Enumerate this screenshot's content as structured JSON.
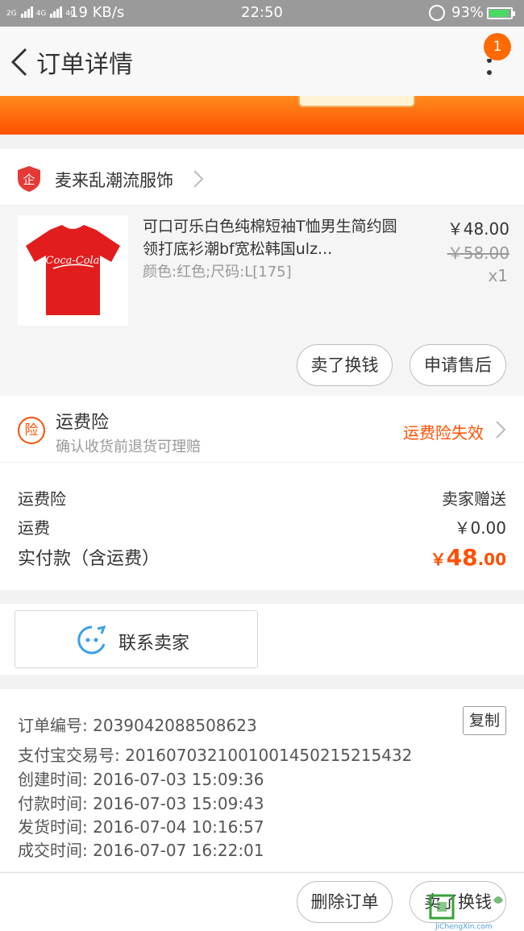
{
  "status_bar": {
    "network_tag_1": "2G",
    "network_tag_2": "4G",
    "network_tag_3": "4G",
    "speed": "19 KB/s",
    "time": "22:50",
    "battery": "93%",
    "battery_level": 0.93
  },
  "header": {
    "title": "订单详情",
    "badge_count": "1"
  },
  "shop": {
    "name": "麦来乱潮流服饰",
    "icon_label": "企"
  },
  "item": {
    "title": "可口可乐白色纯棉短袖T恤男生简约圆领打底衫潮bf宽松韩国ulz...",
    "sku": "颜色:红色;尺码:L[175]",
    "price": "￥48.00",
    "original_price": "￥58.00",
    "quantity": "x1",
    "thumb_text": "Coca-Cola",
    "sell_button": "卖了换钱",
    "after_sale_button": "申请售后"
  },
  "insurance": {
    "icon_label": "险",
    "title": "运费险",
    "subtitle": "确认收货前退货可理赔",
    "status": "运费险失效"
  },
  "fees": {
    "insurance_label": "运费险",
    "insurance_value": "卖家赠送",
    "shipping_label": "运费",
    "shipping_value": "￥0.00",
    "paid_label": "实付款（含运费）",
    "paid_currency": "￥",
    "paid_integer": "48",
    "paid_decimal": ".00"
  },
  "contact": {
    "label": "联系卖家"
  },
  "order_info": {
    "order_no": "订单编号: 2039042088508623",
    "copy_label": "复制",
    "alipay_no": "支付宝交易号: 2016070321001001450215215432",
    "created": "创建时间: 2016-07-03 15:09:36",
    "paid": "付款时间: 2016-07-03 15:09:43",
    "shipped": "发货时间: 2016-07-04 10:16:57",
    "completed": "成交时间: 2016-07-07 16:22:01"
  },
  "bottom": {
    "delete_button": "删除订单",
    "sell_button": "卖了换钱",
    "watermark_text": "JiChengXin.com"
  },
  "colors": {
    "accent": "#ff5000",
    "badge": "#ff6a00",
    "contact_icon": "#3aa0e8"
  }
}
